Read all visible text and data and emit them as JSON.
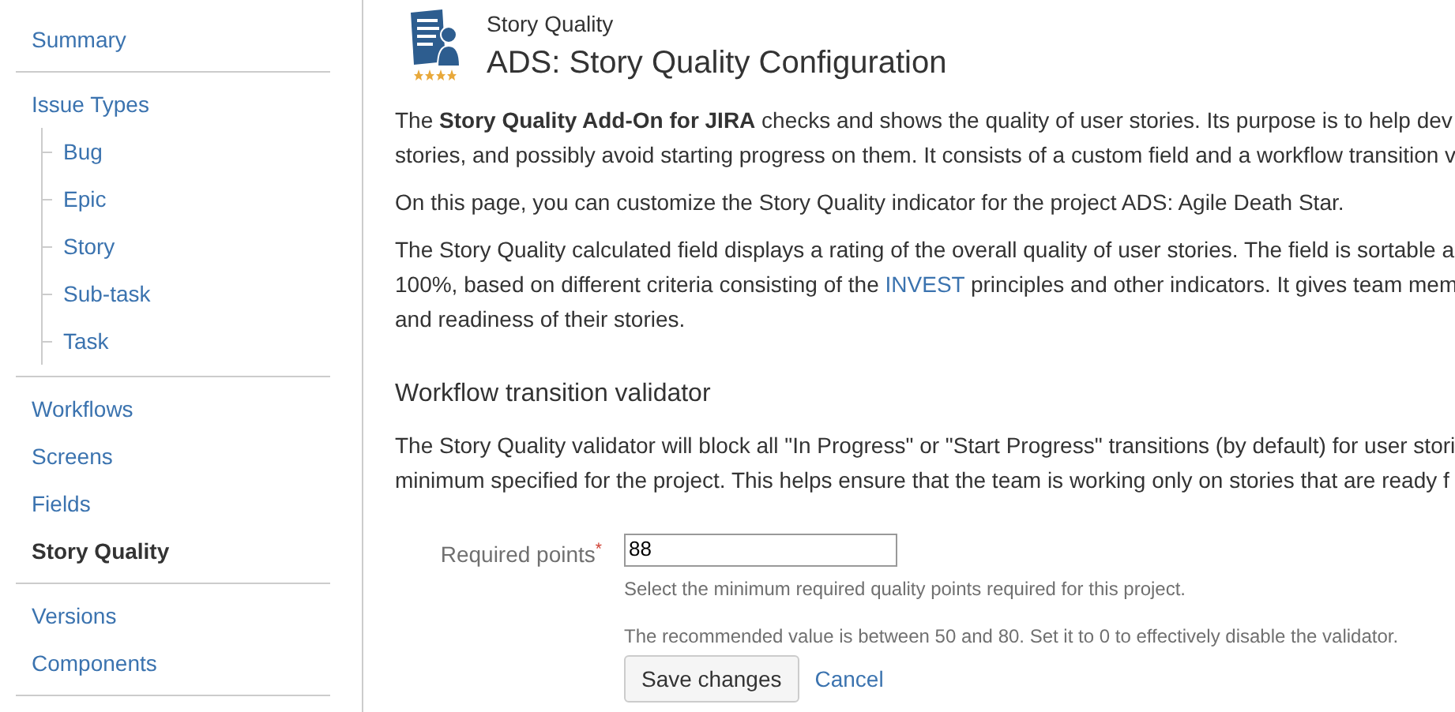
{
  "sidebar": {
    "groups": [
      {
        "items": [
          {
            "label": "Summary",
            "selected": false
          }
        ]
      },
      {
        "items": [
          {
            "label": "Issue Types",
            "selected": false,
            "children": [
              {
                "label": "Bug",
                "selected": false
              },
              {
                "label": "Epic",
                "selected": false
              },
              {
                "label": "Story",
                "selected": false
              },
              {
                "label": "Sub-task",
                "selected": false
              },
              {
                "label": "Task",
                "selected": false
              }
            ]
          }
        ]
      },
      {
        "items": [
          {
            "label": "Workflows",
            "selected": false
          },
          {
            "label": "Screens",
            "selected": false
          },
          {
            "label": "Fields",
            "selected": false
          },
          {
            "label": "Story Quality",
            "selected": true
          }
        ]
      },
      {
        "items": [
          {
            "label": "Versions",
            "selected": false
          },
          {
            "label": "Components",
            "selected": false
          }
        ]
      }
    ]
  },
  "header": {
    "subtitle": "Story Quality",
    "title": "ADS: Story Quality Configuration"
  },
  "intro": [
    {
      "lines": [
        "The **Story Quality Add-On for JIRA** checks and shows the quality of user stories. Its purpose is to help dev",
        "stories, and possibly avoid starting progress on them. It consists of a custom field and a workflow transition v"
      ]
    },
    {
      "lines": [
        "On this page, you can customize the Story Quality indicator for the project ADS: Agile Death Star."
      ]
    },
    {
      "lines": [
        "The Story Quality calculated field displays a rating of the overall quality of user stories. The field is sortable a",
        {
          "before": "100%, based on different criteria consisting of the",
          "link": "INVEST",
          "after": "principles and other indicators. It gives team mem"
        },
        "and readiness of their stories."
      ]
    }
  ],
  "validator": {
    "heading": "Workflow transition validator",
    "lines": [
      "The Story Quality validator will block all \"In Progress\" or \"Start Progress\" transitions (by default) for user stori",
      "minimum specified for the project. This helps ensure that the team is working only on stories that are ready f"
    ],
    "field": {
      "label": "Required points",
      "required_mark": "*",
      "value": "88",
      "help": [
        "Select the minimum required quality points required for this project.",
        "The recommended value is between 50 and 80. Set it to 0 to effectively disable the validator."
      ]
    },
    "buttons": {
      "save": "Save changes",
      "cancel": "Cancel"
    }
  }
}
